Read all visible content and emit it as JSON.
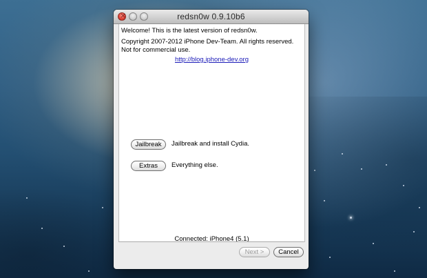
{
  "window": {
    "title": "redsn0w 0.9.10b6"
  },
  "content": {
    "welcome": "Welcome!  This is the latest version of redsn0w.",
    "copyright": "Copyright 2007-2012 iPhone Dev-Team. All rights reserved. Not for commercial use.",
    "link": "http://blog.iphone-dev.org"
  },
  "actions": {
    "jailbreak_button": "Jailbreak",
    "jailbreak_desc": "Jailbreak and install Cydia.",
    "extras_button": "Extras",
    "extras_desc": "Everything else."
  },
  "status": {
    "connected": "Connected: iPhone4 (5.1)"
  },
  "footer": {
    "next_button": "Next >",
    "cancel_button": "Cancel"
  },
  "colors": {
    "link": "#1a1ab8",
    "disabled_text": "#9b9b9b",
    "close_red": "#e1463a"
  }
}
